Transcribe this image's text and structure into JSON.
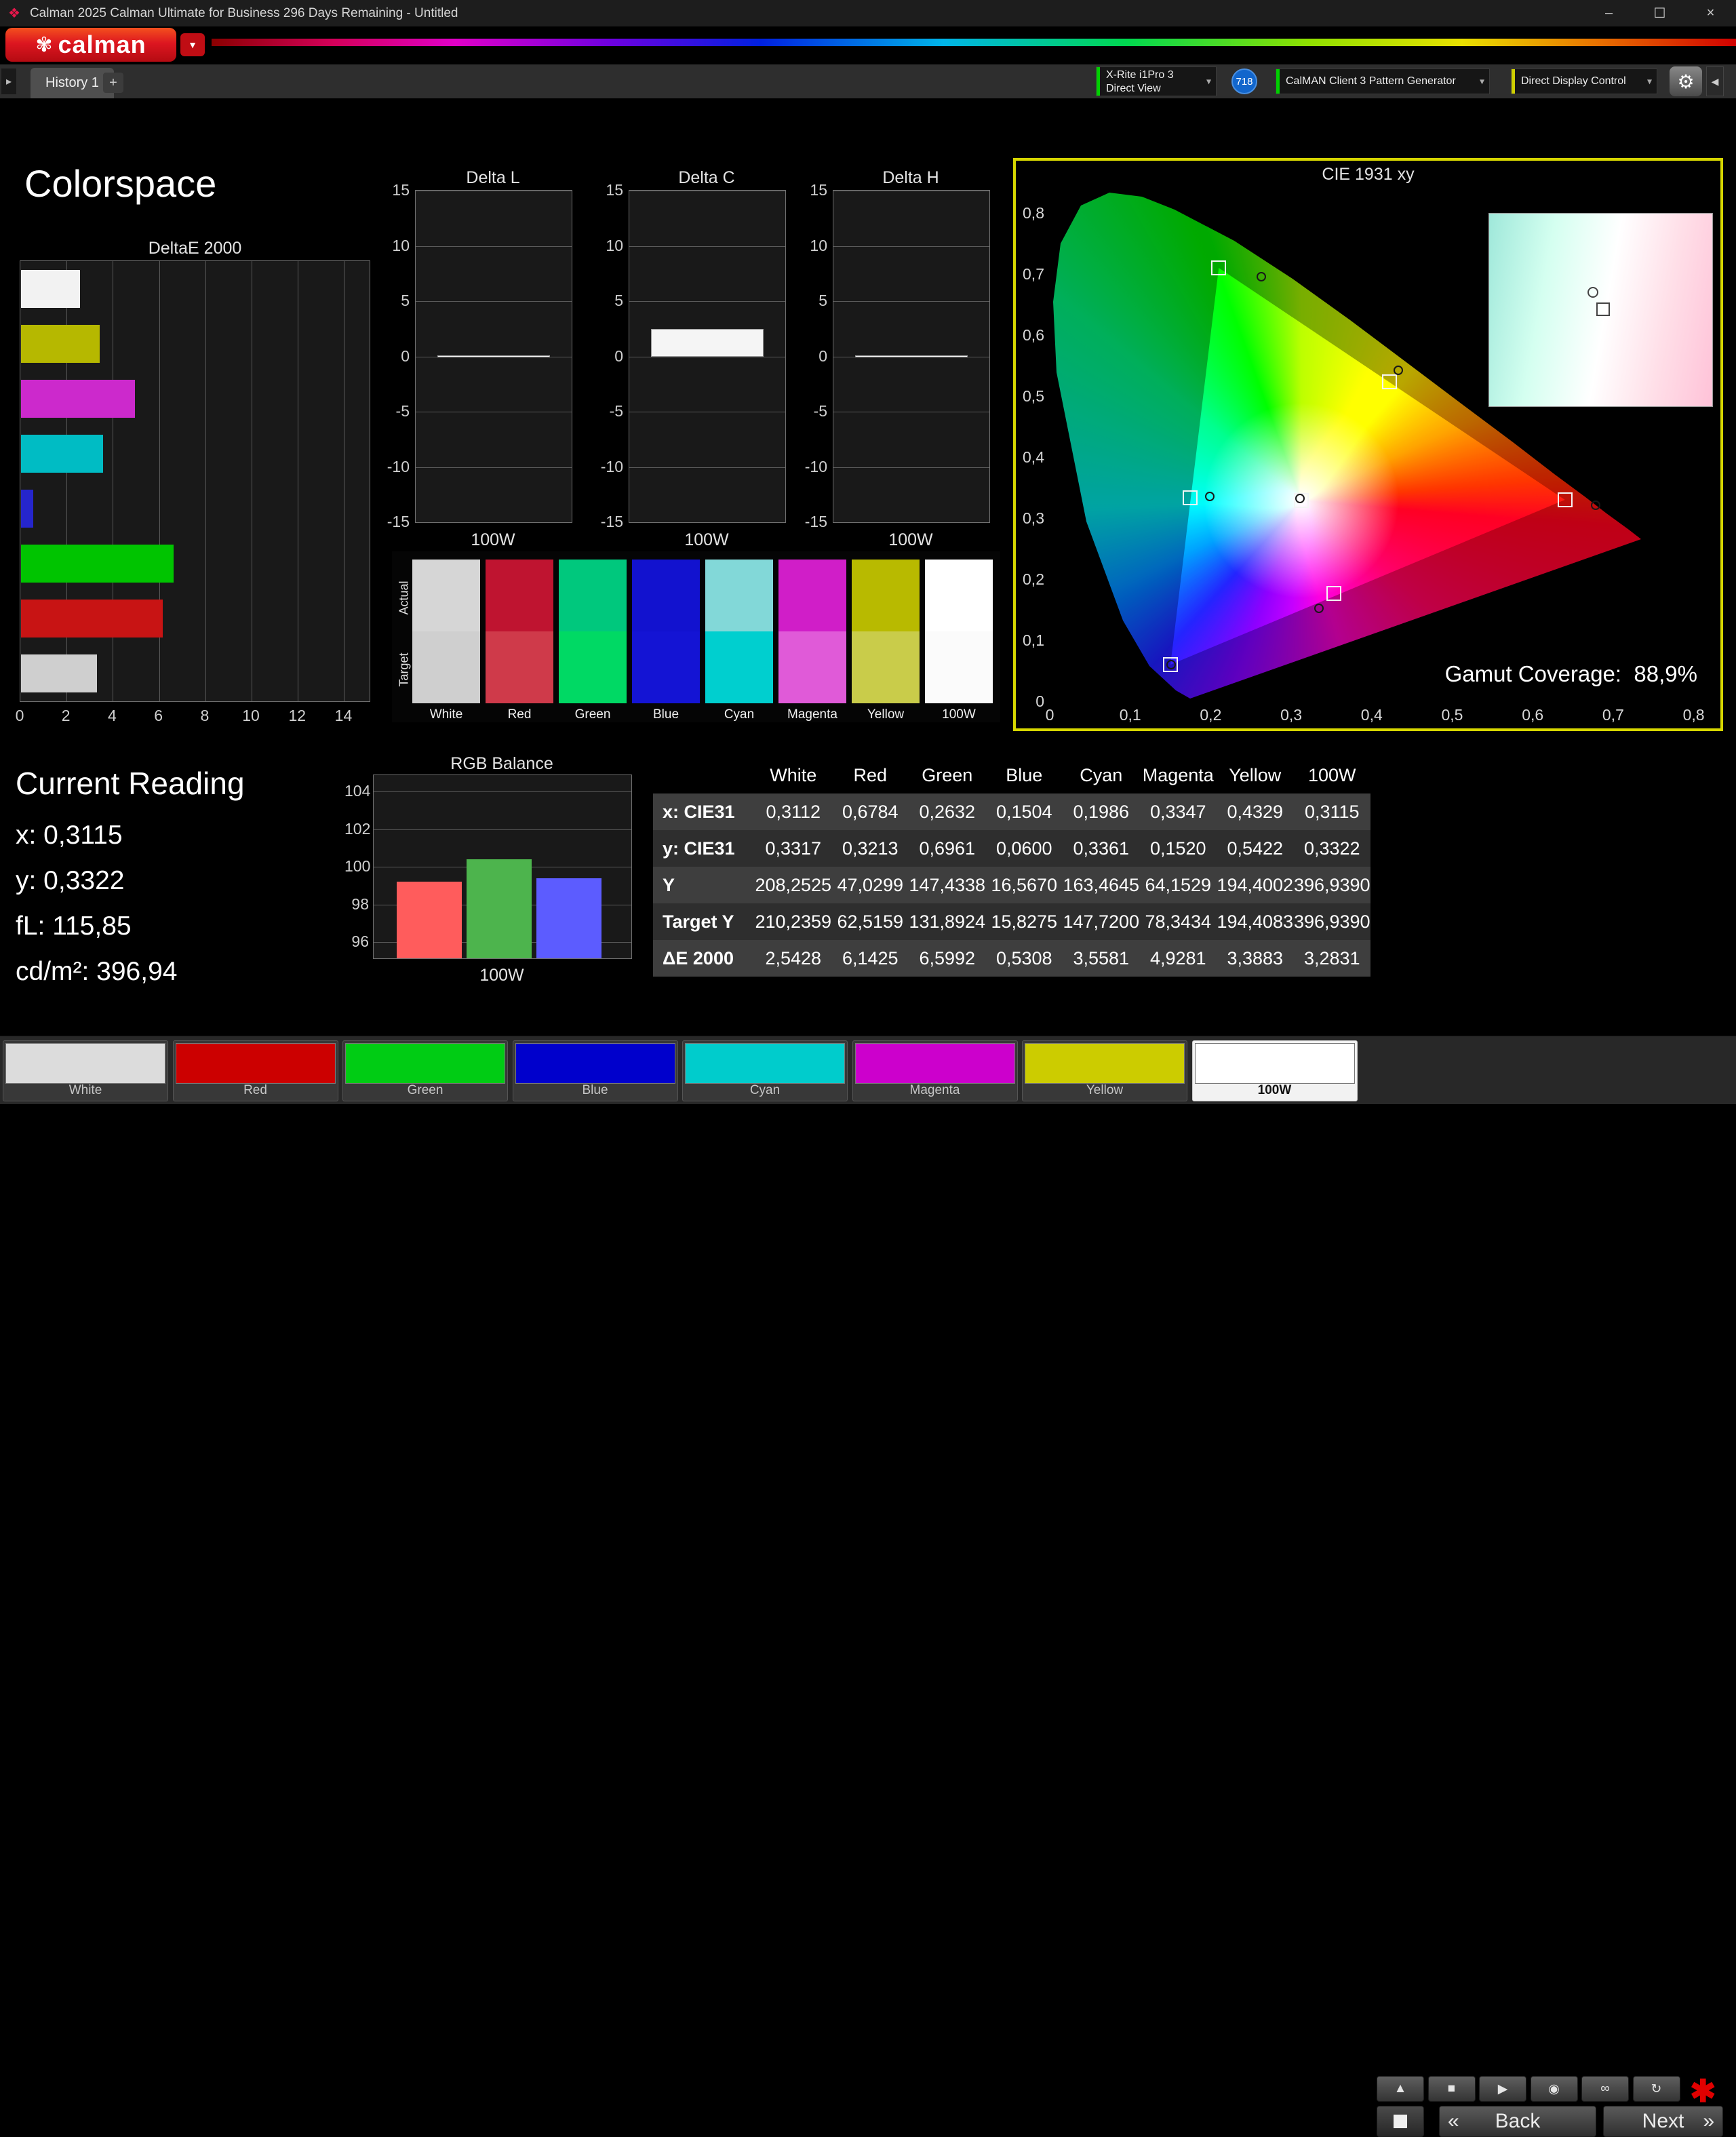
{
  "window": {
    "app_icon": "❖",
    "title": "Calman 2025 Calman Ultimate for Business 296 Days Remaining  - Untitled",
    "minimize": "–",
    "maximize": "☐",
    "close": "×"
  },
  "brand": {
    "flower": "✾",
    "name": "calman",
    "menu_arrow": "▼",
    "accent": "#dd1620"
  },
  "tabs": {
    "nav_arrow": "▸",
    "history": "History 1",
    "add": "+"
  },
  "devices": {
    "meter_line1": "X-Rite i1Pro 3",
    "meter_line2": "Direct View",
    "meter_accent": "#00d000",
    "badge": "718",
    "badge_color": "#1266cc",
    "pattern": "CalMAN Client 3 Pattern Generator",
    "pattern_accent": "#00d000",
    "display": "Direct Display Control",
    "display_accent": "#cfcf00",
    "chevron": "▾",
    "gear": "⚙",
    "collapse": "◀"
  },
  "page_title": "Colorspace",
  "charts": {
    "deltae": {
      "type": "bar",
      "title": "DeltaE 2000",
      "xticks": [
        0,
        2,
        4,
        6,
        8,
        10,
        12,
        14
      ],
      "xmax": 15.1,
      "bars": [
        {
          "label": "White",
          "color": "#f2f2f2",
          "value": 2.5428
        },
        {
          "label": "Yellow",
          "color": "#b6b800",
          "value": 3.3883
        },
        {
          "label": "Magenta",
          "color": "#cc29cc",
          "value": 4.9281
        },
        {
          "label": "Cyan",
          "color": "#00bcc4",
          "value": 3.5581
        },
        {
          "label": "Blue",
          "color": "#2525cc",
          "value": 0.5308
        },
        {
          "label": "Green",
          "color": "#00c400",
          "value": 6.5992
        },
        {
          "label": "Red",
          "color": "#c81414",
          "value": 6.1425
        },
        {
          "label": "100W",
          "color": "#cfcfcf",
          "value": 3.2831
        }
      ]
    },
    "deltas": [
      {
        "id": "delta-l",
        "title": "Delta L",
        "yticks": [
          15,
          10,
          5,
          0,
          -5,
          -10,
          -15
        ],
        "range": 15,
        "category": "100W",
        "value": 0
      },
      {
        "id": "delta-c",
        "title": "Delta C",
        "yticks": [
          15,
          10,
          5,
          0,
          -5,
          -10,
          -15
        ],
        "range": 15,
        "category": "100W",
        "value": 2.5
      },
      {
        "id": "delta-h",
        "title": "Delta H",
        "yticks": [
          15,
          10,
          5,
          0,
          -5,
          -10,
          -15
        ],
        "range": 15,
        "category": "100W",
        "value": 0
      }
    ],
    "rgb": {
      "type": "bar",
      "title": "RGB Balance",
      "yticks": [
        104,
        102,
        100,
        98,
        96
      ],
      "ymin": 96,
      "ymax": 104,
      "category": "100W",
      "bars": [
        {
          "label": "Red",
          "color": "#ff5c5c",
          "value": 99.2
        },
        {
          "label": "Green",
          "color": "#4db44d",
          "value": 100.4
        },
        {
          "label": "Blue",
          "color": "#5c5cff",
          "value": 99.4
        }
      ]
    }
  },
  "swatches": {
    "actual_label": "Actual",
    "target_label": "Target",
    "items": [
      {
        "label": "White",
        "actual": "#d6d6d6",
        "target": "#cfcfcf"
      },
      {
        "label": "Red",
        "actual": "#bf1430",
        "target": "#cf3a4a"
      },
      {
        "label": "Green",
        "actual": "#00c87d",
        "target": "#00d964"
      },
      {
        "label": "Blue",
        "actual": "#1212cf",
        "target": "#1414d4"
      },
      {
        "label": "Cyan",
        "actual": "#82d8d8",
        "target": "#00cfcf"
      },
      {
        "label": "Magenta",
        "actual": "#d01ec8",
        "target": "#e05ad8"
      },
      {
        "label": "Yellow",
        "actual": "#b8ba00",
        "target": "#c9cc4a"
      },
      {
        "label": "100W",
        "actual": "#ffffff",
        "target": "#fbfbfb"
      }
    ]
  },
  "cie": {
    "title": "CIE 1931 xy",
    "xticks": [
      "0",
      "0,1",
      "0,2",
      "0,3",
      "0,4",
      "0,5",
      "0,6",
      "0,7",
      "0,8"
    ],
    "yticks": [
      "0",
      "0,1",
      "0,2",
      "0,3",
      "0,4",
      "0,5",
      "0,6",
      "0,7",
      "0,8"
    ],
    "coverage_label": "Gamut Coverage:",
    "coverage_value": "88,9%",
    "border_color": "#d6d600",
    "target_points": [
      {
        "name": "white",
        "x": 0.3127,
        "y": 0.329
      },
      {
        "name": "red",
        "x": 0.64,
        "y": 0.33
      },
      {
        "name": "green",
        "x": 0.21,
        "y": 0.71
      },
      {
        "name": "blue",
        "x": 0.15,
        "y": 0.06
      },
      {
        "name": "cyan",
        "x": 0.174,
        "y": 0.333
      },
      {
        "name": "magenta",
        "x": 0.353,
        "y": 0.177
      },
      {
        "name": "yellow",
        "x": 0.422,
        "y": 0.523
      }
    ],
    "measured_points": [
      {
        "name": "white",
        "x": 0.3112,
        "y": 0.3317
      },
      {
        "name": "red",
        "x": 0.6784,
        "y": 0.3213
      },
      {
        "name": "green",
        "x": 0.2632,
        "y": 0.6961
      },
      {
        "name": "blue",
        "x": 0.1504,
        "y": 0.06
      },
      {
        "name": "cyan",
        "x": 0.1986,
        "y": 0.3361
      },
      {
        "name": "magenta",
        "x": 0.3347,
        "y": 0.152
      },
      {
        "name": "yellow",
        "x": 0.4329,
        "y": 0.5422
      }
    ]
  },
  "reading": {
    "title": "Current Reading",
    "lines": [
      "x: 0,3115",
      "y: 0,3322",
      "fL: 115,85",
      "cd/m²: 396,94"
    ]
  },
  "table": {
    "columns": [
      "White",
      "Red",
      "Green",
      "Blue",
      "Cyan",
      "Magenta",
      "Yellow",
      "100W"
    ],
    "rows": [
      {
        "label": "x: CIE31",
        "values": [
          "0,3112",
          "0,6784",
          "0,2632",
          "0,1504",
          "0,1986",
          "0,3347",
          "0,4329",
          "0,3115"
        ]
      },
      {
        "label": "y: CIE31",
        "values": [
          "0,3317",
          "0,3213",
          "0,6961",
          "0,0600",
          "0,3361",
          "0,1520",
          "0,5422",
          "0,3322"
        ]
      },
      {
        "label": "Y",
        "values": [
          "208,2525",
          "47,0299",
          "147,4338",
          "16,5670",
          "163,4645",
          "64,1529",
          "194,4002",
          "396,9390"
        ]
      },
      {
        "label": "Target Y",
        "values": [
          "210,2359",
          "62,5159",
          "131,8924",
          "15,8275",
          "147,7200",
          "78,3434",
          "194,4083",
          "396,9390"
        ]
      },
      {
        "label": "ΔE 2000",
        "values": [
          "2,5428",
          "6,1425",
          "6,5992",
          "0,5308",
          "3,5581",
          "4,9281",
          "3,3883",
          "3,2831"
        ]
      }
    ]
  },
  "bottom": {
    "patches": [
      {
        "label": "White",
        "color": "#dcdcdc",
        "selected": false
      },
      {
        "label": "Red",
        "color": "#cc0000",
        "selected": false
      },
      {
        "label": "Green",
        "color": "#00cc14",
        "selected": false
      },
      {
        "label": "Blue",
        "color": "#0000cc",
        "selected": false
      },
      {
        "label": "Cyan",
        "color": "#00cccc",
        "selected": false
      },
      {
        "label": "Magenta",
        "color": "#cc00cc",
        "selected": false
      },
      {
        "label": "Yellow",
        "color": "#cccc00",
        "selected": false
      },
      {
        "label": "100W",
        "color": "#ffffff",
        "selected": true
      }
    ],
    "controls": [
      {
        "name": "level-up",
        "glyph": "▲"
      },
      {
        "name": "stop",
        "glyph": "■"
      },
      {
        "name": "play",
        "glyph": "▶"
      },
      {
        "name": "record",
        "glyph": "◉"
      },
      {
        "name": "loop",
        "glyph": "∞"
      },
      {
        "name": "refresh",
        "glyph": "↻"
      }
    ],
    "asterisk": "✱",
    "back": "Back",
    "next": "Next",
    "back_chevron": "«",
    "next_chevron": "»"
  }
}
